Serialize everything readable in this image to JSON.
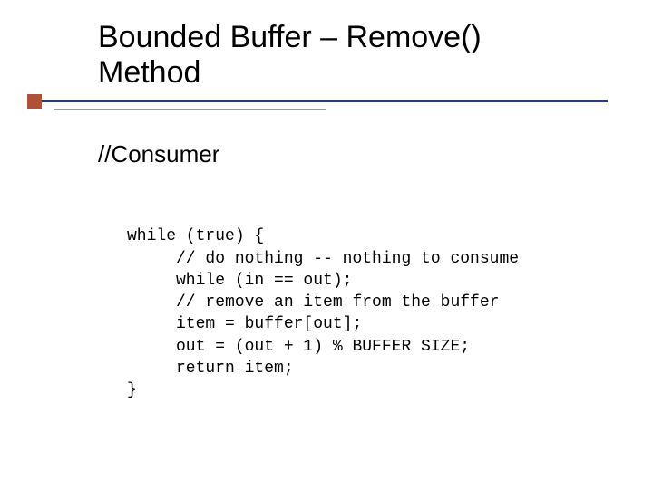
{
  "title": {
    "line1": "Bounded Buffer – Remove()",
    "line2": "Method"
  },
  "subtitle": "//Consumer",
  "code": {
    "l1": "while (true) {",
    "l2": "     // do nothing -- nothing to consume",
    "l3": "     while (in == out);",
    "l4": "     // remove an item from the buffer",
    "l5": "     item = buffer[out];",
    "l6": "     out = (out + 1) % BUFFER SIZE;",
    "l7": "     return item;",
    "l8": "}"
  }
}
